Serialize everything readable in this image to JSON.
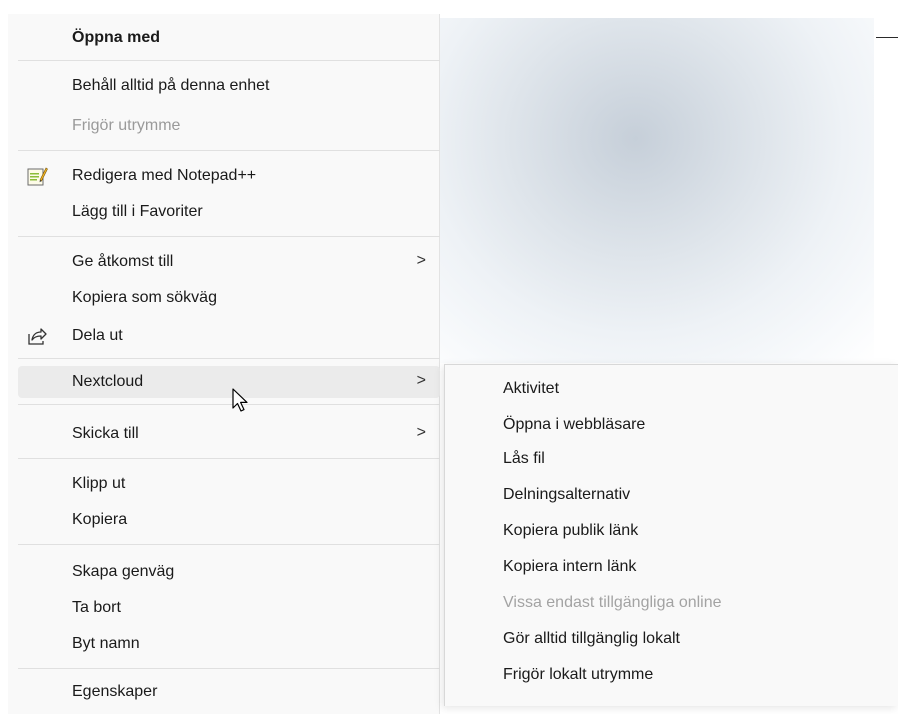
{
  "context_menu": {
    "items": [
      {
        "label": "Öppna med",
        "bold": true
      },
      {
        "label": "Behåll alltid på denna enhet"
      },
      {
        "label": "Frigör utrymme",
        "disabled": true
      },
      {
        "label": "Redigera med Notepad++",
        "icon": "notepad-plus-plus-icon"
      },
      {
        "label": "Lägg till i Favoriter"
      },
      {
        "label": "Ge åtkomst till",
        "arrow": ">"
      },
      {
        "label": "Kopiera som sökväg"
      },
      {
        "label": "Dela ut",
        "icon": "share-icon"
      },
      {
        "label": "Nextcloud",
        "arrow": ">",
        "hover": true
      },
      {
        "label": "Skicka till",
        "arrow": ">"
      },
      {
        "label": "Klipp ut"
      },
      {
        "label": "Kopiera"
      },
      {
        "label": "Skapa genväg"
      },
      {
        "label": "Ta bort"
      },
      {
        "label": "Byt namn"
      },
      {
        "label": "Egenskaper"
      }
    ]
  },
  "nextcloud_submenu": {
    "items": [
      {
        "label": "Aktivitet"
      },
      {
        "label": "Öppna i webbläsare"
      },
      {
        "label": "Lås fil"
      },
      {
        "label": "Delningsalternativ"
      },
      {
        "label": "Kopiera publik länk"
      },
      {
        "label": "Kopiera intern länk"
      },
      {
        "label": "Vissa endast tillgängliga online",
        "disabled": true
      },
      {
        "label": "Gör alltid tillgänglig lokalt"
      },
      {
        "label": "Frigör lokalt utrymme"
      }
    ]
  },
  "colors": {
    "menu_background": "#f9f9f9",
    "hover_background": "#ebebeb",
    "disabled_text": "#9a9a9a",
    "separator": "#e0e0e0"
  }
}
